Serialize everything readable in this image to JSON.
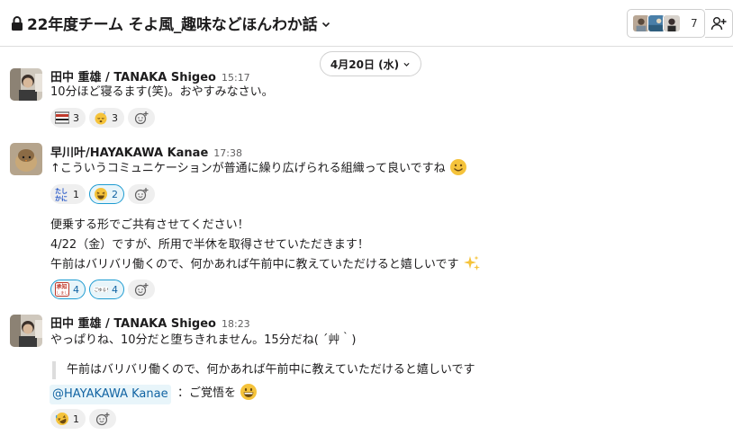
{
  "header": {
    "channel_name": "22年度チーム そよ風_趣味などほんわか話",
    "member_count": "7"
  },
  "date_divider": {
    "label": "4月20日 (水)"
  },
  "messages": [
    {
      "author": "田中 重雄 / TANAKA Shigeo",
      "time": "15:17",
      "text": "10分ほど寝るます(笑)。おやすみなさい。",
      "reactions": [
        {
          "emoji": "oyasumi-stamp",
          "count": "3"
        },
        {
          "emoji": "sleeping-face",
          "count": "3"
        }
      ]
    },
    {
      "author": "早川叶/HAYAKAWA Kanae",
      "time": "17:38",
      "text": "↑こういうコミュニケーションが普通に繰り広げられる組織って良いですね",
      "reactions": [
        {
          "emoji": "tashikani-stamp",
          "count": "1"
        },
        {
          "emoji": "laughing-face",
          "count": "2",
          "active": true
        }
      ],
      "followup": {
        "lines": [
          "便乗する形でご共有させてください！",
          "4/22（金）ですが、所用で半休を取得させていただきます！",
          "午前はバリバリ働くので、何かあれば午前中に教えていただけると嬉しいです"
        ],
        "reactions": [
          {
            "emoji": "shouchi-stamp",
            "count": "4",
            "active": true
          },
          {
            "emoji": "gokigen-stamp",
            "count": "4",
            "active": true
          }
        ]
      }
    },
    {
      "author": "田中 重雄 / TANAKA Shigeo",
      "time": "18:23",
      "text": "やっぱりね、10分だと堕ちきれません。15分だね( ´艸｀)",
      "quote": "午前はバリバリ働くので、何かあれば午前中に教えていただけると嬉しいです",
      "mention": "@HAYAKAWA Kanae",
      "after_mention": "：ご覚悟を",
      "reactions": [
        {
          "emoji": "rofl-face",
          "count": "1"
        }
      ]
    }
  ]
}
